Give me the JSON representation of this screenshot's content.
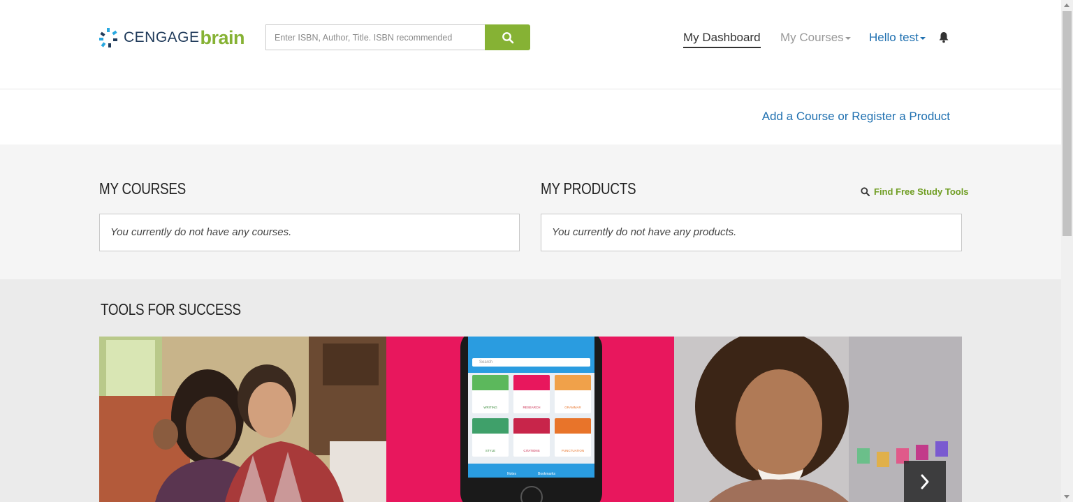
{
  "header": {
    "logo_text_1": "CENGAGE",
    "logo_text_2": "brain",
    "search_placeholder": "Enter ISBN, Author, Title. ISBN recommended",
    "nav_dashboard": "My Dashboard",
    "nav_courses": "My Courses",
    "nav_hello": "Hello test"
  },
  "addbar": {
    "link": "Add a Course or Register a Product"
  },
  "courses": {
    "title": "MY COURSES",
    "empty": "You currently do not have any courses."
  },
  "products": {
    "title": "MY PRODUCTS",
    "find_tools": "Find Free Study Tools",
    "empty": "You currently do not have any products."
  },
  "tools": {
    "title": "TOOLS FOR SUCCESS",
    "app_tiles": [
      {
        "label": "WRITING"
      },
      {
        "label": "RESEARCH"
      },
      {
        "label": "GRAMMAR"
      },
      {
        "label": "STYLE"
      },
      {
        "label": "CITATIONS"
      },
      {
        "label": "PUNCTUATION"
      }
    ],
    "app_search": "Search",
    "app_footer_1": "Notes",
    "app_footer_2": "Bookmarks"
  },
  "colors": {
    "brand_green": "#86b234",
    "link_blue": "#1f70b0",
    "pink": "#e8175d"
  }
}
